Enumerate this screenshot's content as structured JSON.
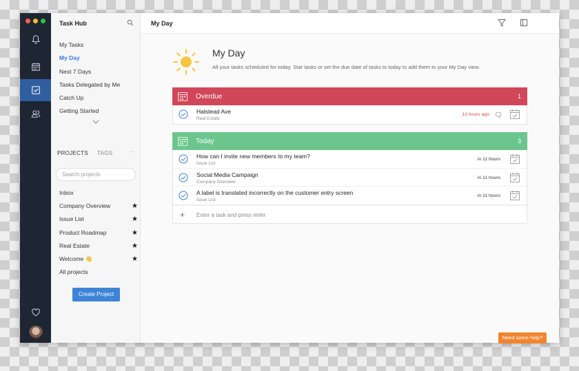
{
  "window": {
    "traffic_lights": [
      "#ff5f56",
      "#ffbd2e",
      "#27c93f"
    ]
  },
  "rail": {
    "items": [
      "bell-icon",
      "calendar-icon",
      "checkbox-icon",
      "people-icon"
    ],
    "active": "checkbox-icon",
    "bottom": [
      "heart-icon",
      "avatar"
    ]
  },
  "sidebar": {
    "title": "Task Hub",
    "nav": [
      {
        "label": "My Tasks"
      },
      {
        "label": "My Day",
        "active": true
      },
      {
        "label": "Next 7 Days"
      },
      {
        "label": "Tasks Delegated by Me"
      },
      {
        "label": "Catch Up"
      },
      {
        "label": "Getting Started"
      }
    ],
    "tabs": {
      "projects": "PROJECTS",
      "tags": "TAGS",
      "more": "···"
    },
    "search_placeholder": "Search projects",
    "projects": [
      {
        "label": "Inbox",
        "starred": false
      },
      {
        "label": "Company Overview",
        "starred": true
      },
      {
        "label": "Issue List",
        "starred": true
      },
      {
        "label": "Product Roadmap",
        "starred": true
      },
      {
        "label": "Real Estate",
        "starred": true
      },
      {
        "label": "Welcome 👋",
        "starred": true
      },
      {
        "label": "All projects",
        "starred": false
      }
    ],
    "create_button": "Create Project"
  },
  "topbar": {
    "title": "My Day"
  },
  "hero": {
    "title": "My Day",
    "subtitle": "All your tasks scheduled for today. Star tasks or set the due date of tasks to today to add them to your My Day view."
  },
  "sections": {
    "overdue": {
      "label": "Overdue",
      "count": "1",
      "color": "#d1475a",
      "tasks": [
        {
          "title": "Halstead Ave",
          "project": "Real Estate",
          "due": "13 hours ago"
        }
      ]
    },
    "today": {
      "label": "Today",
      "count": "3",
      "color": "#6cc58c",
      "tasks": [
        {
          "title": "How can I invite new members to my team?",
          "project": "Issue List",
          "due": "in 11 hours"
        },
        {
          "title": "Social Media Campaign",
          "project": "Company Overview",
          "due": "in 11 hours"
        },
        {
          "title": "A label is translated incorrectly on the customer entry screen",
          "project": "Issue List",
          "due": "in 11 hours"
        }
      ],
      "add_placeholder": "Enter a task and press enter"
    }
  },
  "help_button": "Need some help?",
  "colors": {
    "accent": "#3b7ad4",
    "rail": "#1e2533",
    "help": "#f0842f"
  }
}
